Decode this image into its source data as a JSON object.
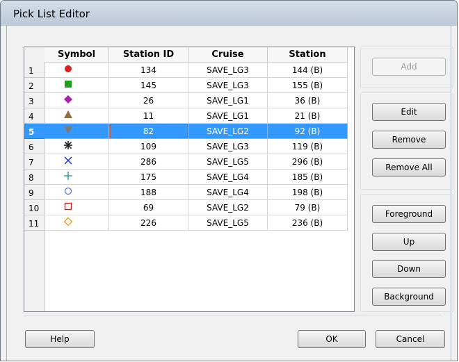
{
  "window": {
    "title": "Pick List Editor"
  },
  "grid": {
    "columns": [
      "Symbol",
      "Station ID",
      "Cruise",
      "Station"
    ],
    "rows": [
      {
        "num": "1",
        "symbol": "red-filled-circle",
        "symbol_color": "#e02020",
        "station_id": "134",
        "cruise": "SAVE_LG3",
        "station": "144 (B)"
      },
      {
        "num": "2",
        "symbol": "green-filled-square",
        "symbol_color": "#1aa01a",
        "station_id": "145",
        "cruise": "SAVE_LG3",
        "station": "155 (B)"
      },
      {
        "num": "3",
        "symbol": "purple-filled-diamond",
        "symbol_color": "#b020b0",
        "station_id": "26",
        "cruise": "SAVE_LG1",
        "station": "36 (B)"
      },
      {
        "num": "4",
        "symbol": "brown-filled-triangle-up",
        "symbol_color": "#9a6b3a",
        "station_id": "11",
        "cruise": "SAVE_LG1",
        "station": "21 (B)"
      },
      {
        "num": "5",
        "symbol": "gray-filled-triangle-down",
        "symbol_color": "#7a7a7a",
        "station_id": "82",
        "cruise": "SAVE_LG2",
        "station": "92 (B)",
        "selected": true
      },
      {
        "num": "6",
        "symbol": "black-asterisk",
        "symbol_color": "#202020",
        "station_id": "109",
        "cruise": "SAVE_LG3",
        "station": "119 (B)"
      },
      {
        "num": "7",
        "symbol": "blue-cross-x",
        "symbol_color": "#2030d0",
        "station_id": "286",
        "cruise": "SAVE_LG5",
        "station": "296 (B)"
      },
      {
        "num": "8",
        "symbol": "teal-plus",
        "symbol_color": "#1a9a9a",
        "station_id": "175",
        "cruise": "SAVE_LG4",
        "station": "185 (B)"
      },
      {
        "num": "9",
        "symbol": "blue-open-circle",
        "symbol_color": "#5a70d8",
        "station_id": "188",
        "cruise": "SAVE_LG4",
        "station": "198 (B)"
      },
      {
        "num": "10",
        "symbol": "red-open-square",
        "symbol_color": "#d02020",
        "station_id": "69",
        "cruise": "SAVE_LG2",
        "station": "79 (B)"
      },
      {
        "num": "11",
        "symbol": "orange-open-diamond",
        "symbol_color": "#e8a020",
        "station_id": "226",
        "cruise": "SAVE_LG5",
        "station": "236 (B)"
      }
    ]
  },
  "buttons": {
    "add": "Add",
    "edit": "Edit",
    "remove": "Remove",
    "remove_all": "Remove All",
    "foreground": "Foreground",
    "up": "Up",
    "down": "Down",
    "background": "Background",
    "help": "Help",
    "ok": "OK",
    "cancel": "Cancel"
  },
  "colors": {
    "selection": "#3399ff"
  }
}
